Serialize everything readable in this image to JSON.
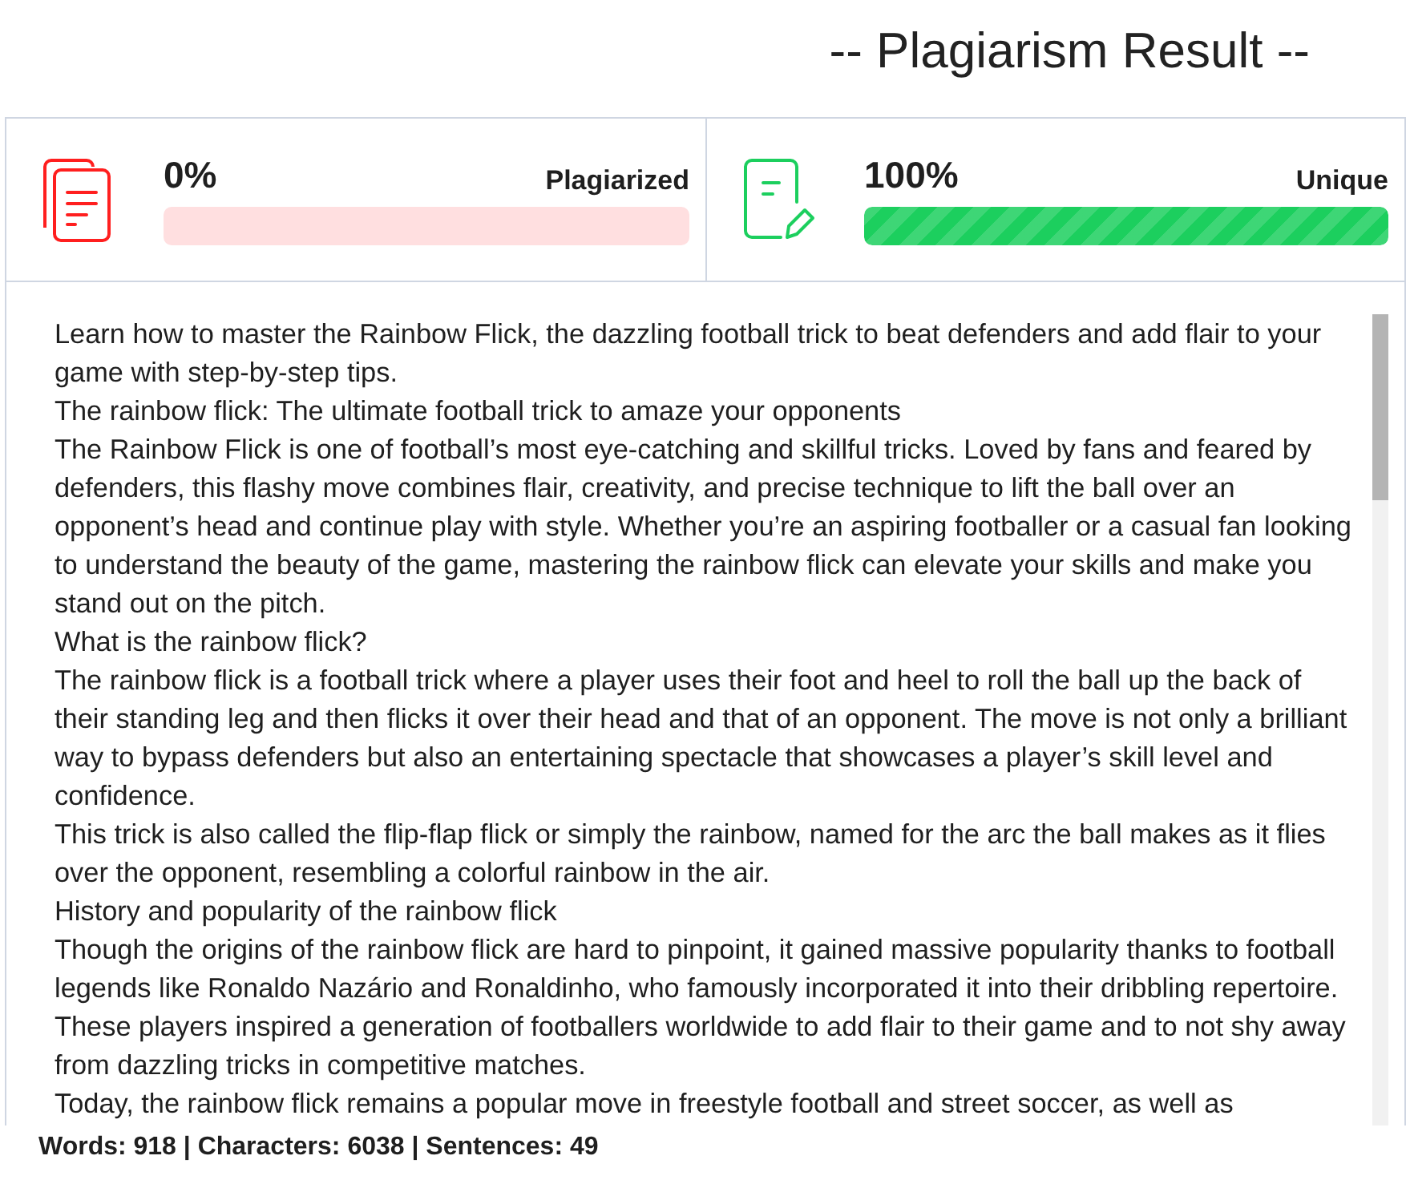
{
  "title": "-- Plagiarism Result --",
  "scores": [
    {
      "kind": "plagiarized",
      "percent": "0%",
      "label": "Plagiarized",
      "level": 0,
      "color": "#ff1f1f"
    },
    {
      "kind": "unique",
      "percent": "100%",
      "label": "Unique",
      "level": 1,
      "color": "#1ccf5e"
    }
  ],
  "paragraphs": [
    "Learn how to master the Rainbow Flick, the dazzling football trick to beat defenders and add flair to your game with step-by-step tips.",
    "The rainbow flick: The ultimate football trick to amaze your opponents",
    "The Rainbow Flick is one of football’s most eye-catching and skillful tricks. Loved by fans and feared by defenders, this flashy move combines flair, creativity, and precise technique to lift the ball over an opponent’s head and continue play with style. Whether you’re an aspiring footballer or a casual fan looking to understand the beauty of the game, mastering the rainbow flick can elevate your skills and make you stand out on the pitch.",
    "What is the rainbow flick?",
    "The rainbow flick is a football trick where a player uses their foot and heel to roll the ball up the back of their standing leg and then flicks it over their head and that of an opponent. The move is not only a brilliant way to bypass defenders but also an entertaining spectacle that showcases a player’s skill level and confidence.",
    "This trick is also called the flip-flap flick or simply the rainbow, named for the arc the ball makes as it flies over the opponent, resembling a colorful rainbow in the air.",
    "History and popularity of the rainbow flick",
    "Though the origins of the rainbow flick are hard to pinpoint, it gained massive popularity thanks to football legends like Ronaldo Nazário and Ronaldinho, who famously incorporated it into their dribbling repertoire. These players inspired a generation of footballers worldwide to add flair to their game and to not shy away from dazzling tricks in competitive matches.",
    "Today, the rainbow flick remains a popular move in freestyle football and street soccer, as well as"
  ],
  "stats": "Words: 918 | Characters: 6038 | Sentences: 49"
}
